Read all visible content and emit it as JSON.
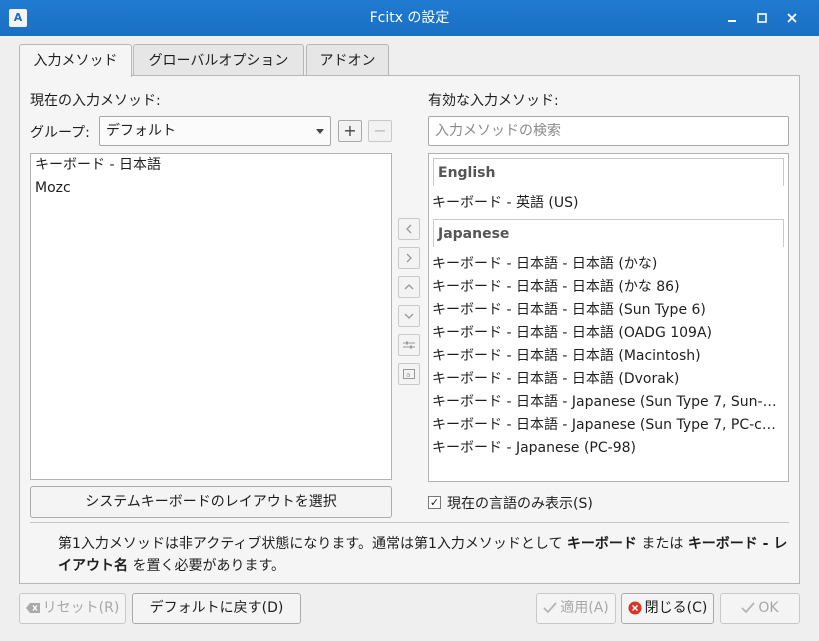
{
  "window": {
    "title": "Fcitx の設定",
    "icon_letter": "A"
  },
  "tabs": [
    {
      "label": "入力メソッド",
      "active": true
    },
    {
      "label": "グローバルオプション",
      "active": false
    },
    {
      "label": "アドオン",
      "active": false
    }
  ],
  "left": {
    "heading": "現在の入力メソッド:",
    "group_label": "グループ:",
    "group_value": "デフォルト",
    "add_label": "+",
    "remove_label": "−",
    "items": [
      "キーボード - 日本語",
      "Mozc"
    ],
    "system_button": "システムキーボードのレイアウトを選択"
  },
  "right": {
    "heading": "有効な入力メソッド:",
    "search_placeholder": "入力メソッドの検索",
    "sections": [
      {
        "header": "English",
        "items": [
          "キーボード - 英語 (US)"
        ]
      },
      {
        "header": "Japanese",
        "items": [
          "キーボード - 日本語 - 日本語 (かな)",
          "キーボード - 日本語 - 日本語 (かな 86)",
          "キーボード - 日本語 - 日本語 (Sun Type 6)",
          "キーボード - 日本語 - 日本語 (OADG 109A)",
          "キーボード - 日本語 - 日本語 (Macintosh)",
          "キーボード - 日本語 - 日本語 (Dvorak)",
          "キーボード - 日本語 - Japanese (Sun Type 7, Sun-…",
          "キーボード - 日本語 - Japanese (Sun Type 7, PC-c…",
          "キーボード - Japanese (PC-98)"
        ]
      }
    ],
    "checkbox_checked": true,
    "checkbox_label": "現在の言語のみ表示(S)"
  },
  "note": {
    "part1": "第1入力メソッドは非アクティブ状態になります。通常は第1入力メソッドとして",
    "bold1": "キーボード",
    "part2": "または",
    "bold2": "キーボード - レイアウト名",
    "part3": "を置く必要があります。"
  },
  "buttons": {
    "reset": "リセット(R)",
    "default": "デフォルトに戻す(D)",
    "apply": "適用(A)",
    "close": "閉じる(C)",
    "ok": "OK"
  },
  "icons": {
    "move_left": "chevron-left-icon",
    "move_right": "chevron-right-icon",
    "move_up": "chevron-up-icon",
    "move_down": "chevron-down-icon",
    "configure": "settings-icon",
    "layout": "keyboard-layout-icon"
  },
  "colors": {
    "titlebar": "#1f7bd1",
    "close_icon": "#d9342b"
  }
}
